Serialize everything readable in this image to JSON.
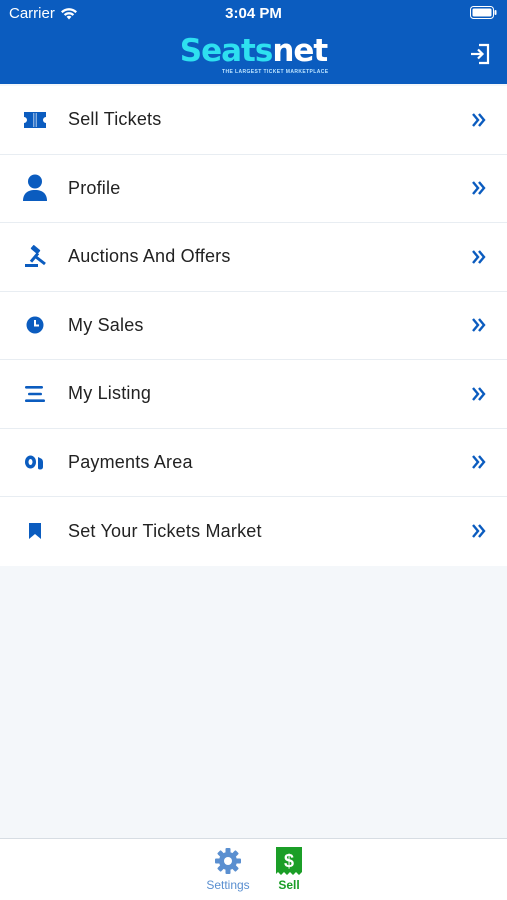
{
  "status_bar": {
    "carrier": "Carrier",
    "time": "3:04 PM"
  },
  "header": {
    "logo_seats": "Seats",
    "logo_net": "net",
    "logo_tagline": "THE LARGEST TICKET MARKETPLACE",
    "logout_icon": "logout-icon"
  },
  "colors": {
    "header_bg": "#0b5cbf",
    "accent_blue": "#0b5cbf",
    "logo_cyan": "#2ee0f0",
    "sell_green": "#1b9e27",
    "background": "#f4f7fa"
  },
  "menu": {
    "items": [
      {
        "label": "Sell Tickets",
        "icon": "ticket-icon"
      },
      {
        "label": "Profile",
        "icon": "user-icon"
      },
      {
        "label": "Auctions And Offers",
        "icon": "gavel-icon"
      },
      {
        "label": "My Sales",
        "icon": "clock-icon"
      },
      {
        "label": "My Listing",
        "icon": "list-icon"
      },
      {
        "label": "Payments Area",
        "icon": "coins-icon"
      },
      {
        "label": "Set Your Tickets Market",
        "icon": "bookmark-icon"
      }
    ],
    "chevron_icon": "double-chevron-right-icon"
  },
  "tabbar": {
    "settings_label": "Settings",
    "sell_label": "Sell",
    "active": "Sell"
  }
}
